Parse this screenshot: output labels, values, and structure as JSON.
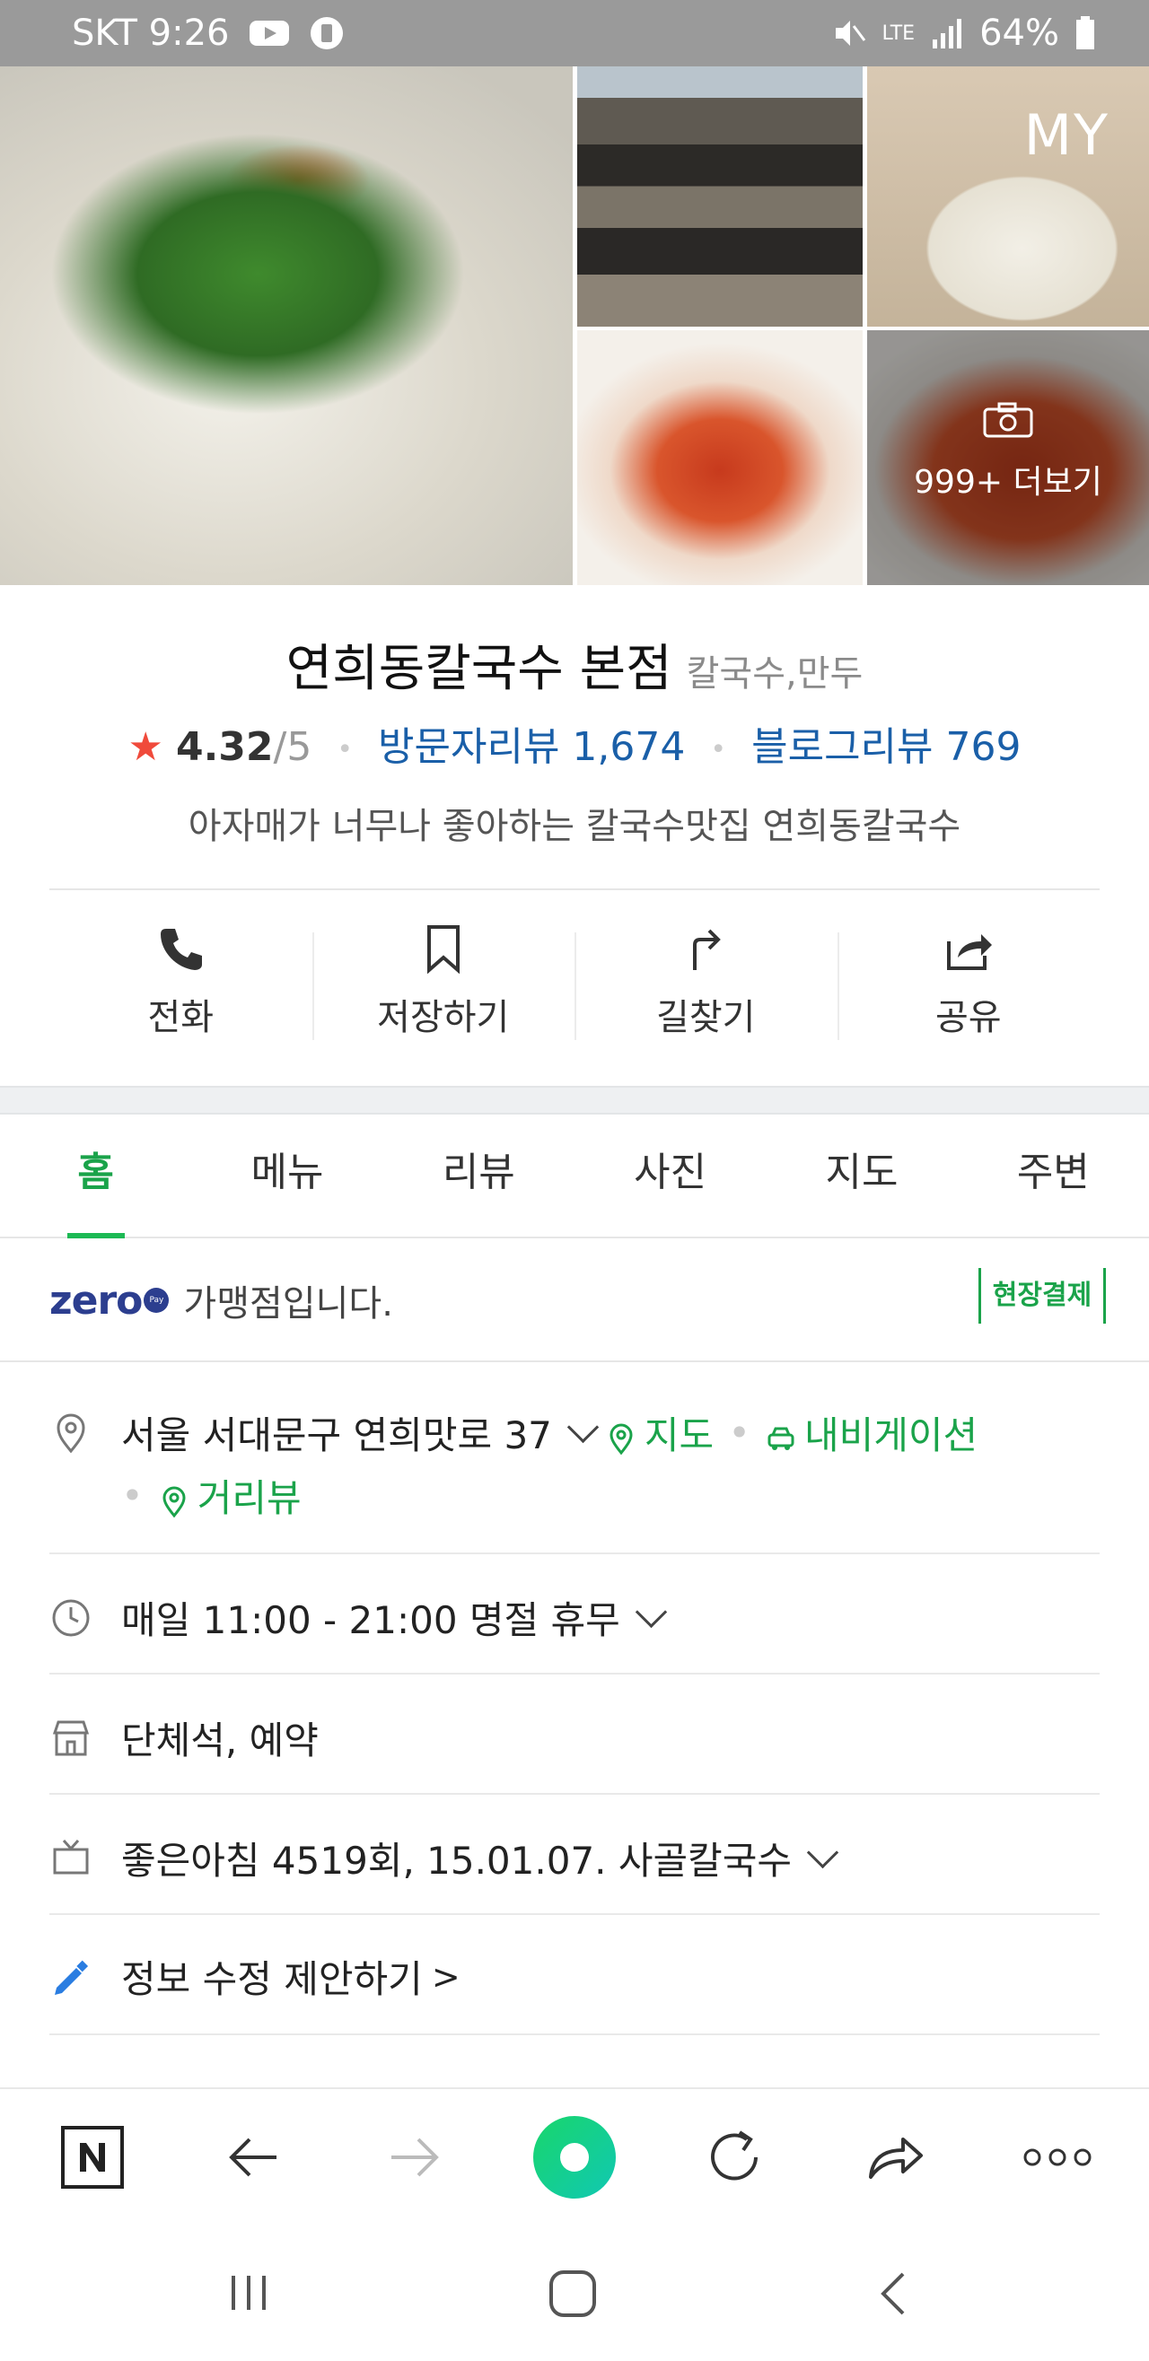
{
  "status_bar": {
    "carrier_time": "SKT 9:26",
    "network": "LTE",
    "battery": "64%"
  },
  "photos": {
    "my_label": "MY",
    "more_label": "999+ 더보기"
  },
  "place": {
    "name": "연희동칼국수 본점",
    "category": "칼국수,만두",
    "rating": "4.32",
    "rating_max": "/5",
    "visitor_review": "방문자리뷰 1,674",
    "blog_review": "블로그리뷰 769",
    "description": "아자매가 너무나 좋아하는 칼국수맛집 연희동칼국수"
  },
  "actions": [
    {
      "label": "전화",
      "icon": "phone-icon"
    },
    {
      "label": "저장하기",
      "icon": "bookmark-icon"
    },
    {
      "label": "길찾기",
      "icon": "directions-icon"
    },
    {
      "label": "공유",
      "icon": "share-icon"
    }
  ],
  "tabs": [
    "홈",
    "메뉴",
    "리뷰",
    "사진",
    "지도",
    "주변"
  ],
  "active_tab": "홈",
  "zeropay": {
    "logo": "zero",
    "text": "가맹점입니다.",
    "badge": "현장결제"
  },
  "info": {
    "address": "서울 서대문구 연희맛로 37",
    "map_link": "지도",
    "navi_link": "내비게이션",
    "street_view": "거리뷰",
    "hours": "매일 11:00 - 21:00 명절 휴무",
    "facilities": "단체석, 예약",
    "tv": "좋은아침 4519회, 15.01.07. 사골칼국수",
    "edit_suggest": "정보 수정 제안하기"
  },
  "colors": {
    "accent_green": "#1aa34a",
    "link_blue": "#1a5fa8",
    "star_red": "#f04a3b",
    "zero_navy": "#2c3e8f"
  }
}
